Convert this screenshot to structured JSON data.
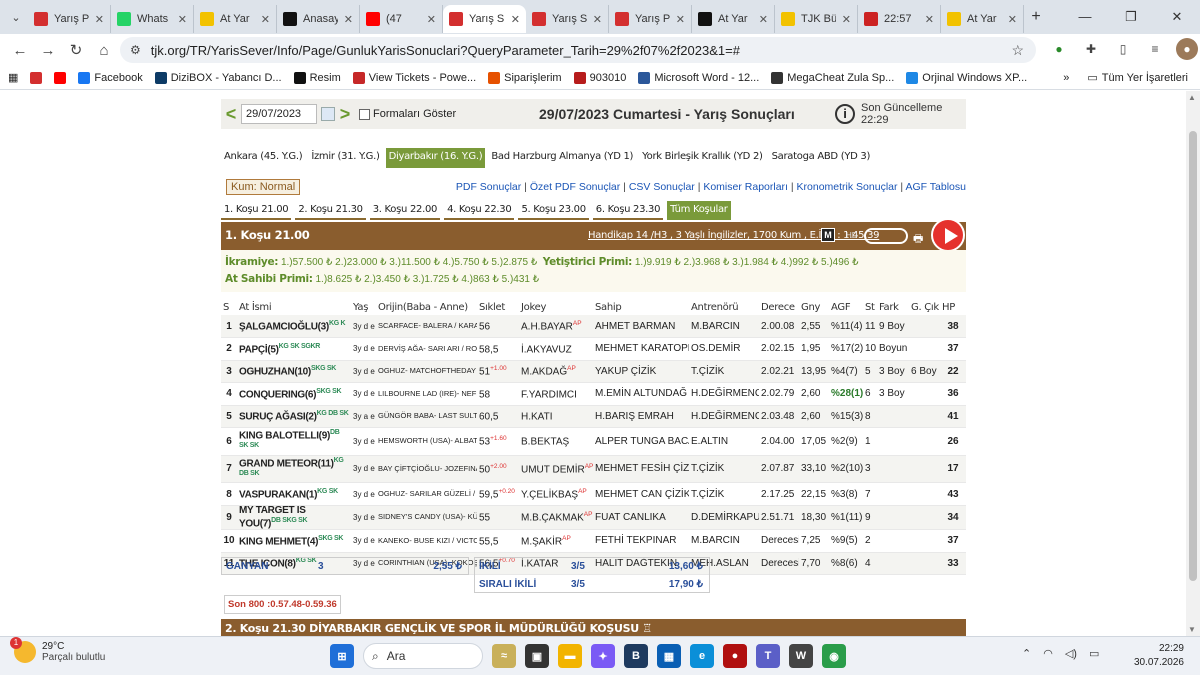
{
  "browser": {
    "tabs": [
      {
        "title": "Yarış P",
        "color": "#d32f2f"
      },
      {
        "title": "Whats",
        "color": "#25d366"
      },
      {
        "title": "At Yar",
        "color": "#f2c200"
      },
      {
        "title": "Anasay",
        "color": "#111111"
      },
      {
        "title": "(47",
        "color": "#ff0000"
      },
      {
        "title": "Yarış S",
        "color": "#d32f2f"
      },
      {
        "title": "Yarış S",
        "color": "#d32f2f"
      },
      {
        "title": "Yarış P",
        "color": "#d32f2f"
      },
      {
        "title": "At Yar",
        "color": "#111111"
      },
      {
        "title": "TJK Bü",
        "color": "#f2c200"
      },
      {
        "title": "22:57",
        "color": "#cc2222"
      },
      {
        "title": "At Yar",
        "color": "#f2c200"
      }
    ],
    "active_tab_index": 5,
    "url": "tjk.org/TR/YarisSever/Info/Page/GunlukYarisSonuclari?QueryParameter_Tarih=29%2f07%2f2023&1=#",
    "bookmarks": [
      "Facebook",
      "DiziBOX - Yabancı D...",
      "Resim",
      "View Tickets - Powe...",
      "Siparişlerim",
      "903010",
      "Microsoft Word - 12...",
      "MegaCheat Zula Sp...",
      "Orjinal Windows XP..."
    ],
    "bookmarks_more": "»",
    "all_bookmarks": "Tüm Yer İşaretleri"
  },
  "page": {
    "date_value": "29/07/2023",
    "show_forms_label": "Formaları Göster",
    "title": "29/07/2023 Cumartesi - Yarış Sonuçları",
    "updated": "Son Güncelleme 22:29",
    "city_tabs": [
      "Ankara (45. Y.G.)",
      "İzmir (31. Y.G.)",
      "Diyarbakır (16. Y.G.)",
      "Bad Harzburg Almanya (YD 1)",
      "York Birleşik Krallık (YD 2)",
      "Saratoga ABD (YD 3)"
    ],
    "active_city": 2,
    "track": "Kum: Normal",
    "links": [
      "PDF Sonuçlar",
      "Özet PDF Sonuçlar",
      "CSV Sonuçlar",
      "Komiser Raporları",
      "Kronometrik Sonuçlar",
      "AGF Tablosu"
    ],
    "race_tabs": [
      "1. Koşu 21.00",
      "2. Koşu 21.30",
      "3. Koşu 22.00",
      "4. Koşu 22.30",
      "5. Koşu 23.00",
      "6. Koşu 23.30",
      "Tüm Koşular"
    ],
    "active_race_tab": 6
  },
  "race1": {
    "title": "1. Koşu 21.00",
    "info": "Handikap 14 /H3 , 3 Yaşlı İngilizler, 1700 Kum , E.İ.D. : 1.45.39",
    "m_label": "M",
    "hd_label": "HD",
    "prize_line1": {
      "ikramiye_label": "İkramiye:",
      "ikramiye": "1.)57.500 ₺  2.)23.000 ₺  3.)11.500 ₺  4.)5.750 ₺  5.)2.875 ₺",
      "yetistirici_label": "Yetiştirici Primi:",
      "yetistirici": "1.)9.919 ₺  2.)3.968 ₺  3.)1.984 ₺  4.)992 ₺  5.)496 ₺"
    },
    "prize_line2": {
      "sahip_label": "At Sahibi Primi:",
      "sahip": "1.)8.625 ₺  2.)3.450 ₺  3.)1.725 ₺  4.)863 ₺  5.)431 ₺"
    },
    "headers": [
      "S",
      "At İsmi",
      "Yaş",
      "Orijin(Baba - Anne)",
      "Sıklet",
      "Jokey",
      "Sahip",
      "Antrenörü",
      "Derece",
      "Gny",
      "AGF",
      "St",
      "Fark",
      "G. Çık",
      "HP"
    ],
    "rows": [
      {
        "s": "1",
        "name": "ŞALGAMCIOĞLU(3)",
        "tag": "KG K",
        "yas": "3y d e",
        "origin": "SCARFACE- BALERA / KARABEYHAN (GB)",
        "siklet": "56",
        "siklet_sup": "",
        "jokey": "A.H.BAYAR",
        "jokey_sup": "AP",
        "sahip": "AHMET BARMAN",
        "antrenor": "M.BARCIN",
        "derece": "2.00.08",
        "gny": "2,55",
        "agf": "%11(4)",
        "st": "11",
        "fark": "9 Boy",
        "gcik": "",
        "hp": "38"
      },
      {
        "s": "2",
        "name": "PAPÇİ(5)",
        "tag": "KG SK SGKR",
        "yas": "3y d e",
        "origin": "DERVİŞ AĞA- SARI ARI / ROYAL ABJAR (USA)",
        "siklet": "58,5",
        "siklet_sup": "",
        "jokey": "İ.AKYAVUZ",
        "jokey_sup": "",
        "sahip": "MEHMET KARATOPRAK",
        "antrenor": "OS.DEMİR",
        "derece": "2.02.15",
        "gny": "1,95",
        "agf": "%17(2)",
        "st": "10",
        "fark": "Boyun",
        "gcik": "",
        "hp": "37"
      },
      {
        "s": "3",
        "name": "OGHUZHAN(10)",
        "tag": "SKG SK",
        "yas": "3y d e",
        "origin": "OGHUZ- MATCHOFTHEDAY (IRE) / HAWK WING (USA)",
        "siklet": "51",
        "siklet_sup": "+1.00",
        "jokey": "M.AKDAĞ",
        "jokey_sup": "AP",
        "sahip": "YAKUP ÇİZİK",
        "antrenor": "T.ÇİZİK",
        "derece": "2.02.21",
        "gny": "13,95",
        "agf": "%4(7)",
        "st": "5",
        "fark": "3 Boy",
        "gcik": "6 Boy",
        "hp": "22"
      },
      {
        "s": "4",
        "name": "CONQUERING(6)",
        "tag": "SKG SK",
        "yas": "3y d e",
        "origin": "LILBOURNE LAD (IRE)- NEFESKESEN / NITRO (GB)",
        "siklet": "58",
        "siklet_sup": "",
        "jokey": "F.YARDIMCI",
        "jokey_sup": "",
        "sahip": "M.EMİN ALTUNDAĞ",
        "antrenor": "H.DEĞİRMENCİ",
        "derece": "2.02.79",
        "gny": "2,60",
        "agf": "%28(1)",
        "st": "6",
        "fark": "3 Boy",
        "gcik": "",
        "hp": "36"
      },
      {
        "s": "5",
        "name": "SURUÇ AĞASI(2)",
        "tag": "KG DB SK",
        "yas": "3y a e",
        "origin": "GÜNGÖR BABA- LAST SULTAN / NURSULTAN",
        "siklet": "60,5",
        "siklet_sup": "",
        "jokey": "H.KATI",
        "jokey_sup": "",
        "sahip": "H.BARIŞ EMRAH",
        "antrenor": "H.DEĞİRMENCİ",
        "derece": "2.03.48",
        "gny": "2,60",
        "agf": "%15(3)",
        "st": "8",
        "fark": "",
        "gcik": "",
        "hp": "41"
      },
      {
        "s": "6",
        "name": "KING BALOTELLI(9)",
        "tag": "DB SK SK",
        "yas": "3y d e",
        "origin": "HEMSWORTH (USA)- ALBATRAOZ / AFTER MARKET (USA)",
        "siklet": "53",
        "siklet_sup": "+1.60",
        "jokey": "B.BEKTAŞ",
        "jokey_sup": "",
        "sahip": "ALPER TUNGA BACANLI",
        "antrenor": "E.ALTIN",
        "derece": "2.04.00",
        "gny": "17,05",
        "agf": "%2(9)",
        "st": "1",
        "fark": "",
        "gcik": "",
        "hp": "26"
      },
      {
        "s": "7",
        "name": "GRAND METEOR(11)",
        "tag": "KG DB SK",
        "yas": "3y d e",
        "origin": "BAY ÇİFTÇİOĞLU- JOZEFINA / BİN AJWAAD (IRE)",
        "siklet": "50",
        "siklet_sup": "+2.00",
        "jokey": "UMUT DEMİR",
        "jokey_sup": "AP",
        "sahip": "MEHMET FESİH ÇİZİK",
        "antrenor": "T.ÇİZİK",
        "derece": "2.07.87",
        "gny": "33,10",
        "agf": "%2(10)",
        "st": "3",
        "fark": "",
        "gcik": "",
        "hp": "17"
      },
      {
        "s": "8",
        "name": "VASPURAKAN(1)",
        "tag": "KG SK",
        "yas": "3y d e",
        "origin": "OGHUZ- SARILAR GÜZELİ / MUJTAHID (USA)",
        "siklet": "59,5",
        "siklet_sup": "+0.20",
        "jokey": "Y.ÇELİKBAŞ",
        "jokey_sup": "AP",
        "sahip": "MEHMET CAN ÇİZİK",
        "antrenor": "T.ÇİZİK",
        "derece": "2.17.25",
        "gny": "22,15",
        "agf": "%3(8)",
        "st": "7",
        "fark": "",
        "gcik": "",
        "hp": "43"
      },
      {
        "s": "9",
        "name": "MY TARGET IS YOU(7)",
        "tag": "DB SKG SK",
        "yas": "3y d e",
        "origin": "SIDNEY'S CANDY (USA)- KÜÇÜK BEYZA / LUXOR",
        "siklet": "55",
        "siklet_sup": "",
        "jokey": "M.B.ÇAKMAK",
        "jokey_sup": "AP",
        "sahip": "FUAT CANLIKA",
        "antrenor": "D.DEMİRKAPU",
        "derece": "2.51.71",
        "gny": "18,30",
        "agf": "%1(11)",
        "st": "9",
        "fark": "",
        "gcik": "",
        "hp": "34"
      },
      {
        "s": "10",
        "name": "KING MEHMET(4)",
        "tag": "SKG SK",
        "yas": "3y d e",
        "origin": "KANEKO- BUSE KIZI / VICTORY GALLOP (CAN)",
        "siklet": "55,5",
        "siklet_sup": "",
        "jokey": "M.ŞAKİR",
        "jokey_sup": "AP",
        "sahip": "FETHİ TEKPINAR",
        "antrenor": "M.BARCIN",
        "derece": "Derecesiz",
        "gny": "7,25",
        "agf": "%9(5)",
        "st": "2",
        "fark": "",
        "gcik": "",
        "hp": "37"
      },
      {
        "s": "11",
        "name": "THE ICON(8)",
        "tag": "KG SK",
        "yas": "3y d e",
        "origin": "CORINTHIAN (USA)- KOKOŞ / EKINOKS GULCH (USA)",
        "siklet": "56,5",
        "siklet_sup": "+0.70",
        "jokey": "İ.KATAR",
        "jokey_sup": "",
        "sahip": "HALİT DAĞTEKİN",
        "antrenor": "MEH.ASLAN",
        "derece": "Derecesiz",
        "gny": "7,70",
        "agf": "%8(6)",
        "st": "4",
        "fark": "",
        "gcik": "",
        "hp": "33"
      }
    ],
    "bets": {
      "ganyan_label": "GANYAN",
      "ganyan_no": "3",
      "ganyan_val": "2,55 ₺",
      "ikili_label": "İKİLİ",
      "ikili_no": "3/5",
      "ikili_val": "13,60 ₺",
      "sirali_label": "SIRALI İKİLİ",
      "sirali_no": "3/5",
      "sirali_val": "17,90 ₺"
    },
    "son800": "Son 800 :0.57.48-0.59.36"
  },
  "race2": {
    "title": "2. Koşu 21.30 DİYARBAKIR GENÇLİK VE SPOR İL MÜDÜRLÜĞÜ KOŞUSU"
  },
  "taskbar": {
    "temp": "29°C",
    "weather": "Parçalı bulutlu",
    "weather_badge": "1",
    "search": "Ara",
    "time": "22:29",
    "date": "30.07.2026"
  }
}
